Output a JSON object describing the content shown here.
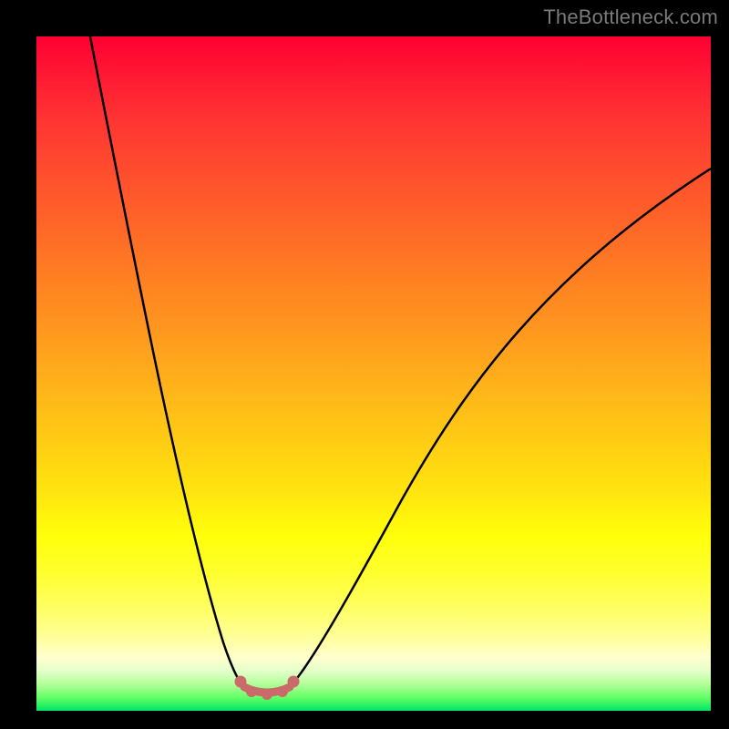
{
  "watermark": "TheBottleneck.com",
  "chart_data": {
    "type": "line",
    "title": "",
    "xlabel": "",
    "ylabel": "",
    "xlim": [
      0,
      100
    ],
    "ylim": [
      0,
      100
    ],
    "background_gradient": {
      "orientation": "vertical",
      "stops": [
        {
          "pos": 0.0,
          "color": "#ff0033"
        },
        {
          "pos": 0.5,
          "color": "#ffb31a"
        },
        {
          "pos": 0.8,
          "color": "#ffff33"
        },
        {
          "pos": 0.92,
          "color": "#ffffcc"
        },
        {
          "pos": 1.0,
          "color": "#00e666"
        }
      ]
    },
    "series": [
      {
        "name": "bottleneck-curve",
        "color": "#000000",
        "x": [
          7,
          12,
          17,
          22,
          26,
          29,
          31,
          34,
          38,
          44,
          52,
          62,
          74,
          88,
          100
        ],
        "y": [
          100,
          78,
          56,
          36,
          18,
          6,
          2,
          2,
          6,
          18,
          34,
          50,
          64,
          76,
          84
        ]
      }
    ],
    "highlight": {
      "name": "optimal-range",
      "color": "#cb6a6a",
      "x": [
        30,
        31.5,
        33,
        34.5,
        36,
        38
      ],
      "y": [
        4,
        2,
        1.5,
        1.5,
        2,
        4
      ]
    },
    "annotations": [
      {
        "text": "TheBottleneck.com",
        "position": "top-right",
        "color": "#7a7a7a"
      }
    ]
  }
}
